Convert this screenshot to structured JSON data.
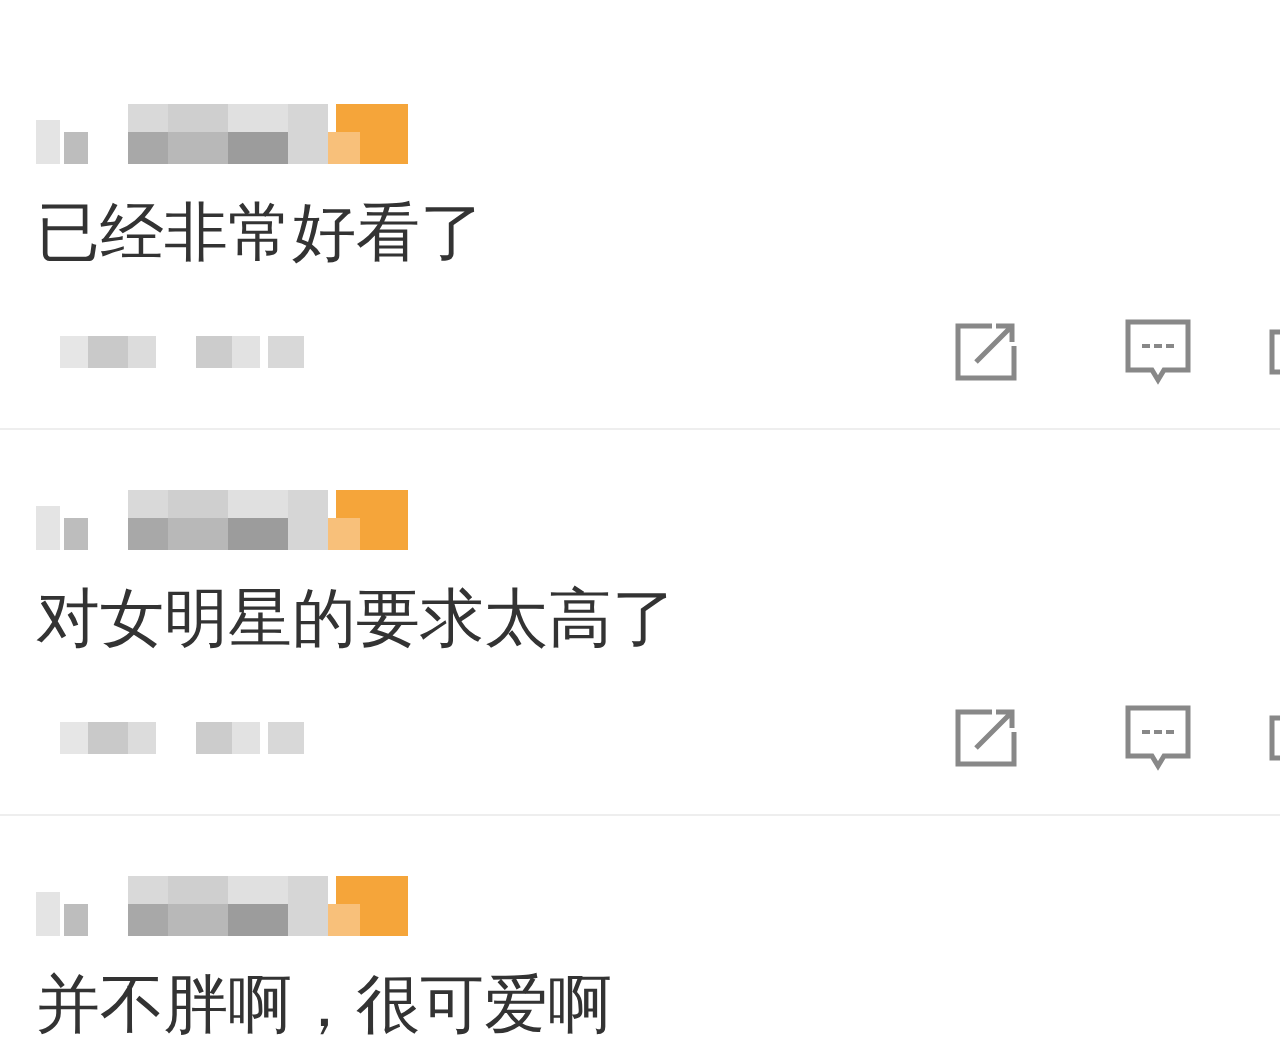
{
  "comments": [
    {
      "text": "已经非常好看了",
      "actions": true
    },
    {
      "text": "对女明星的要求太高了",
      "actions": true
    },
    {
      "text": "并不胖啊，很可爱啊",
      "actions": false
    }
  ]
}
